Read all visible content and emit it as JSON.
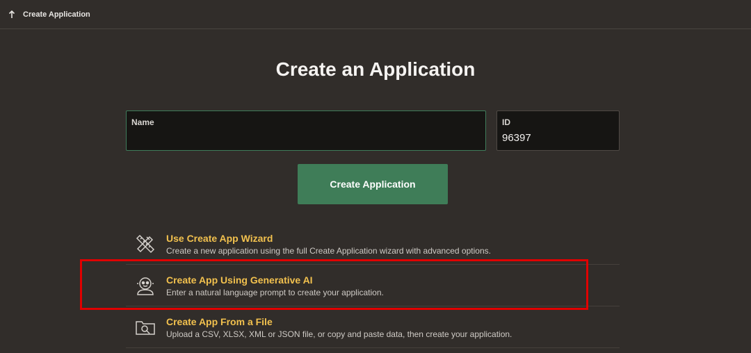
{
  "topbar": {
    "breadcrumb": "Create Application",
    "icon": "arrow-up-icon"
  },
  "title": "Create an Application",
  "form": {
    "name_label": "Name",
    "name_value": "",
    "id_label": "ID",
    "id_value": "96397"
  },
  "create_button_label": "Create Application",
  "options": [
    {
      "icon": "wizard-tools-icon",
      "title": "Use Create App Wizard",
      "description": "Create a new application using the full Create Application wizard with advanced options."
    },
    {
      "icon": "generative-ai-robot-icon",
      "title": "Create App Using Generative AI",
      "description": "Enter a natural language prompt to create your application."
    },
    {
      "icon": "file-search-icon",
      "title": "Create App From a File",
      "description": "Upload a CSV, XLSX, XML or JSON file, or copy and paste data, then create your application."
    }
  ],
  "colors": {
    "background": "#312d2a",
    "primary_button": "#3f7d58",
    "link_title": "#f2c14e",
    "annotation_highlight": "#e00000"
  }
}
